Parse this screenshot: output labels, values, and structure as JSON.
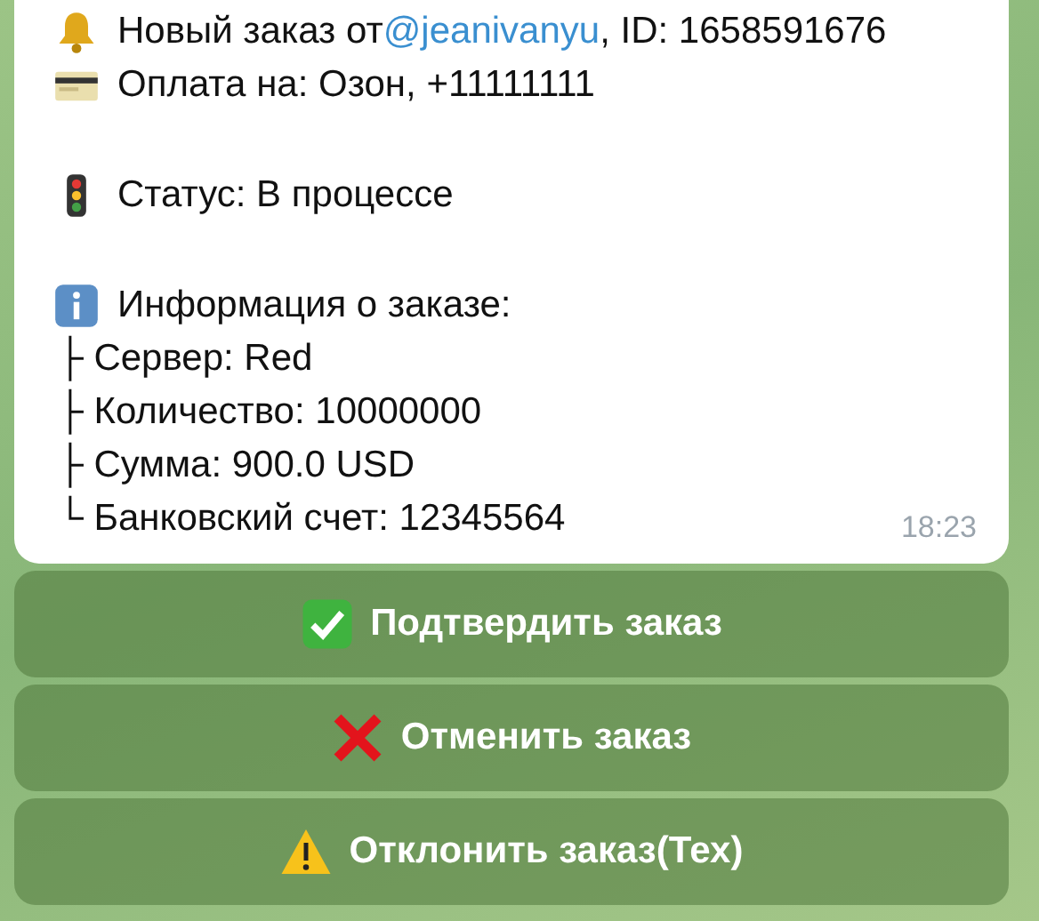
{
  "message": {
    "paragraphs": [
      [
        {
          "kind": "mention",
          "before": "Новый заказ от ",
          "link": "@jeanivanyu",
          "after": ", ID: 1658591676"
        },
        {
          "kind": "icon",
          "text": "Оплата на: Озон, +11111111"
        }
      ],
      [
        {
          "kind": "icon",
          "text": "Статус: В процессе"
        }
      ],
      [
        {
          "kind": "icon",
          "text": "Информация о заказе:"
        },
        {
          "kind": "plain",
          "text": "├ Сервер: Red"
        },
        {
          "kind": "plain",
          "text": "├ Количество: 10000000"
        },
        {
          "kind": "plain",
          "text": "├ Сумма: 900.0 USD"
        },
        {
          "kind": "plain",
          "text": "└ Банковский счет: 12345564"
        }
      ]
    ],
    "time": "18:23"
  },
  "buttons": [
    {
      "label": "Подтвердить заказ"
    },
    {
      "label": "Отменить заказ"
    },
    {
      "label": "Отклонить заказ(Тех)"
    }
  ]
}
